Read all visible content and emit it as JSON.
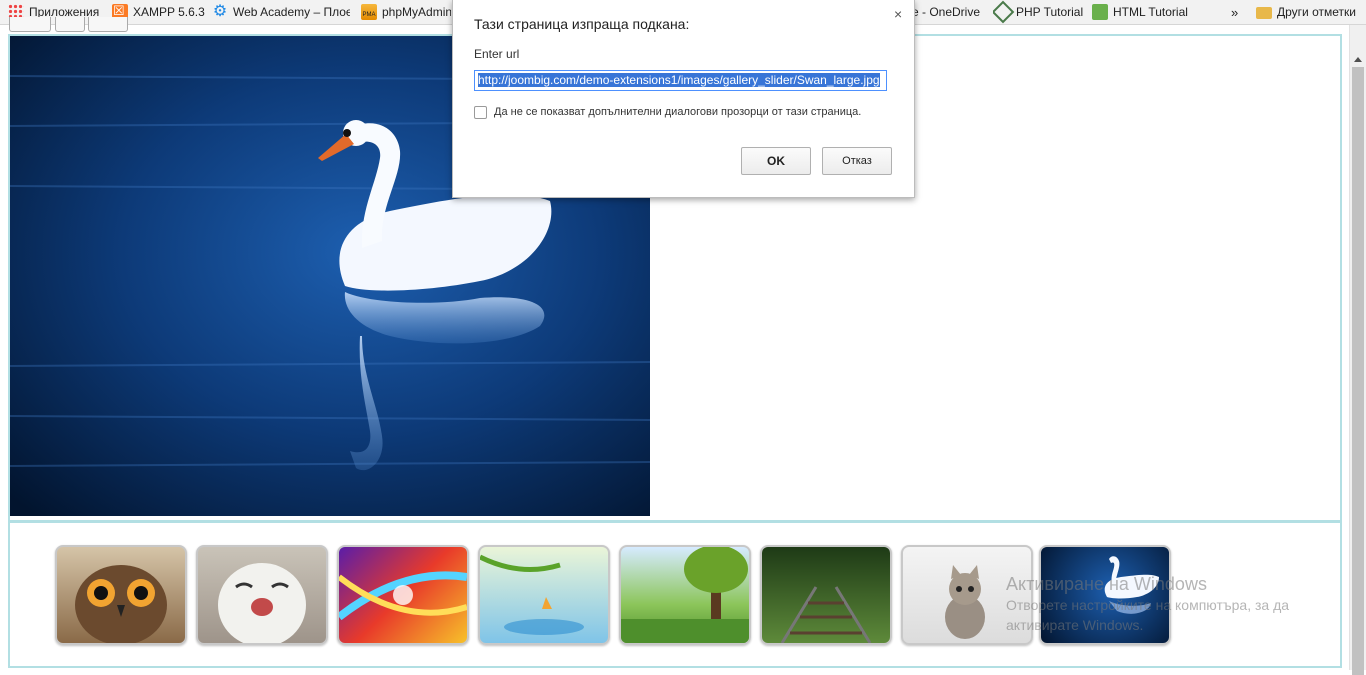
{
  "bookmarks": {
    "items": [
      {
        "label": "Приложения",
        "icon": "apps-grid-icon"
      },
      {
        "label": "XAMPP 5.6.3",
        "icon": "xampp-icon"
      },
      {
        "label": "Web Academy – Плое",
        "icon": "gear-icon"
      },
      {
        "label": "phpMyAdmin",
        "icon": "phpmyadmin-icon"
      },
      {
        "label": "e - OneDrive",
        "icon": ""
      },
      {
        "label": "PHP Tutorial",
        "icon": "diamond-icon"
      },
      {
        "label": "HTML Tutorial",
        "icon": "code-icon"
      }
    ],
    "overflow": "»",
    "other": {
      "label": "Други отметки",
      "icon": "folder-icon"
    }
  },
  "dialog": {
    "title": "Тази страница изпраща подкана:",
    "close": "×",
    "message": "Enter url",
    "input_value": "http://joombig.com/demo-extensions1/images/gallery_slider/Swan_large.jpg",
    "checkbox_label": "Да не се показват допълнителни диалогови прозорци от тази страница.",
    "ok": "OK",
    "cancel": "Отказ"
  },
  "gallery": {
    "main_image": "swan",
    "thumbnails": [
      "owl",
      "snowy-owl",
      "abstract-swirl",
      "butterfly-water",
      "tree-meadow",
      "railway-forest",
      "kitten",
      "swan"
    ]
  },
  "watermark": {
    "title": "Активиране на Windows",
    "subtitle_line1": "Отворете настройките на компютъра, за да",
    "subtitle_line2": "активирате Windows."
  }
}
